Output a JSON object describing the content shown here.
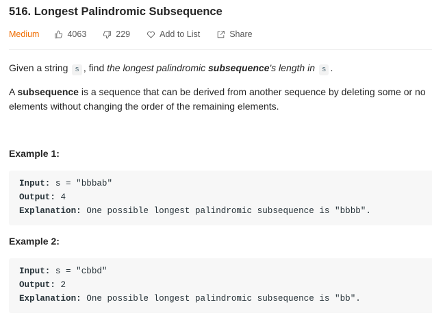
{
  "problem": {
    "title": "516. Longest Palindromic Subsequence",
    "difficulty": "Medium",
    "likes": "4063",
    "dislikes": "229",
    "add_to_list": "Add to List",
    "share": "Share",
    "colors": {
      "difficulty": "#ef6c00",
      "text": "#262626",
      "muted": "#595959",
      "code_bg": "#f7f7f7"
    }
  },
  "description": {
    "p1_start": "Given a string ",
    "p1_code1": "s",
    "p1_mid": ", find ",
    "p1_italic_a": "the longest palindromic ",
    "p1_bold_italic": "subsequence",
    "p1_italic_b": "'s length in ",
    "p1_code2": "s",
    "p1_end": ".",
    "p2_start": "A ",
    "p2_bold": "subsequence",
    "p2_rest_line1": " is a sequence that can be derived from another sequence by deleting some or no",
    "p2_line2": "elements without changing the order of the remaining elements."
  },
  "examples": [
    {
      "heading": "Example 1:",
      "input_label": "Input:",
      "input_value": " s = \"bbbab\"",
      "output_label": "Output:",
      "output_value": " 4",
      "explanation_label": "Explanation:",
      "explanation_value": " One possible longest palindromic subsequence is \"bbbb\"."
    },
    {
      "heading": "Example 2:",
      "input_label": "Input:",
      "input_value": " s = \"cbbd\"",
      "output_label": "Output:",
      "output_value": " 2",
      "explanation_label": "Explanation:",
      "explanation_value": " One possible longest palindromic subsequence is \"bb\"."
    }
  ]
}
